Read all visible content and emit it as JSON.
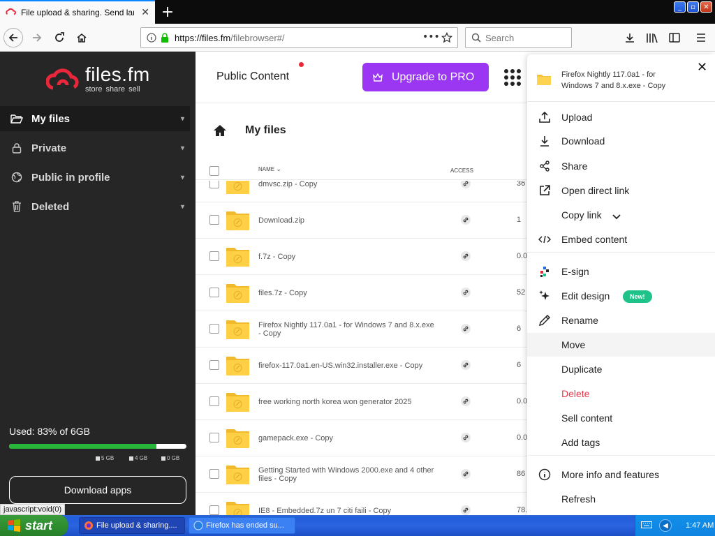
{
  "browser": {
    "tab_title": "File upload & sharing. Send large f",
    "url_host": "https://files.fm",
    "url_path": "/filebrowser#/",
    "search_placeholder": "Search"
  },
  "sidebar": {
    "brand": "files.fm",
    "tagline": "store share sell",
    "items": [
      {
        "label": "My files",
        "icon": "folder-open-icon"
      },
      {
        "label": "Private",
        "icon": "lock-icon"
      },
      {
        "label": "Public in profile",
        "icon": "globe-icon"
      },
      {
        "label": "Deleted",
        "icon": "trash-icon"
      }
    ],
    "usage_text": "Used: 83% of 6GB",
    "usage_fraction": 0.83,
    "legend": [
      "5 GB",
      "4 GB",
      "0 GB"
    ],
    "download_apps": "Download apps",
    "status_url": "javascript:void(0)"
  },
  "topbar": {
    "public_content": "Public Content",
    "upgrade": "Upgrade to PRO"
  },
  "main": {
    "breadcrumb_title": "My files",
    "col_name": "NAME",
    "col_access": "ACCESS",
    "files": [
      {
        "name": "dmvsc.zip - Copy",
        "size": "36"
      },
      {
        "name": "Download.zip",
        "size": "1"
      },
      {
        "name": "f.7z - Copy",
        "size": "0.0"
      },
      {
        "name": "files.7z - Copy",
        "size": "52"
      },
      {
        "name": "Firefox Nightly 117.0a1 - for Windows 7 and 8.x.exe - Copy",
        "size": "6"
      },
      {
        "name": "firefox-117.0a1.en-US.win32.installer.exe - Copy",
        "size": "6"
      },
      {
        "name": "free working north korea won generator 2025",
        "size": "0.0"
      },
      {
        "name": "gamepack.exe - Copy",
        "size": "0.0"
      },
      {
        "name": "Getting Started with Windows 2000.exe and 4 other files - Copy",
        "size": "86"
      },
      {
        "name": "IE8 - Embedded.7z un 7 citi faili - Copy",
        "size": "78."
      }
    ]
  },
  "panel": {
    "file_name": "Firefox Nightly 117.0a1 - for Windows 7 and 8.x.exe - Copy",
    "new_badge": "New!",
    "menu": [
      {
        "label": "Upload",
        "icon": "upload-icon"
      },
      {
        "label": "Download",
        "icon": "download-icon"
      },
      {
        "label": "Share",
        "icon": "share-icon"
      },
      {
        "label": "Open direct link",
        "icon": "external-link-icon"
      },
      {
        "label": "Copy link",
        "icon": ""
      },
      {
        "label": "Embed content",
        "icon": "code-icon"
      },
      {
        "label": "E-sign",
        "icon": "esign-icon"
      },
      {
        "label": "Edit design",
        "icon": "sparkle-icon"
      },
      {
        "label": "Rename",
        "icon": "pencil-icon"
      },
      {
        "label": "Move",
        "icon": ""
      },
      {
        "label": "Duplicate",
        "icon": ""
      },
      {
        "label": "Delete",
        "icon": ""
      },
      {
        "label": "Sell content",
        "icon": ""
      },
      {
        "label": "Add tags",
        "icon": ""
      },
      {
        "label": "More info and features",
        "icon": "info-icon"
      },
      {
        "label": "Refresh",
        "icon": ""
      }
    ]
  },
  "taskbar": {
    "start": "start",
    "items": [
      "File upload & sharing....",
      "Firefox has ended su..."
    ],
    "clock": "1:47 AM"
  },
  "colors": {
    "accent_purple": "#9b36f2",
    "usage_green": "#25b63a",
    "delete_red": "#e53a4c",
    "new_badge": "#1fc38a",
    "logo_red": "#e8283a"
  }
}
